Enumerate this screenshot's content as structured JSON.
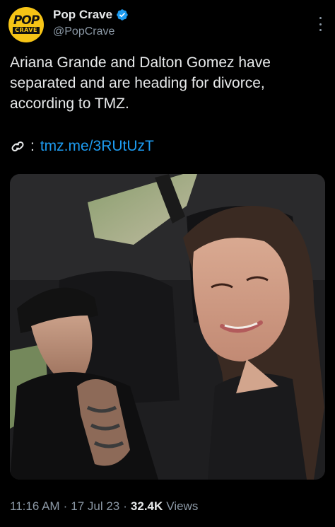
{
  "account": {
    "display_name": "Pop Crave",
    "handle": "@PopCrave",
    "avatar_text_top": "POP",
    "avatar_text_bottom": "CRAVE",
    "verified": true,
    "avatar_color": "#f6c416"
  },
  "tweet": {
    "text": "Ariana Grande and Dalton Gomez have separated and are heading for divorce, according to TMZ.",
    "link_prefix": ":",
    "link_text": "tmz.me/3RUtUzT",
    "link_color": "#1d9bf0",
    "link_icon": "link-icon"
  },
  "media": {
    "icon": "photo"
  },
  "meta": {
    "time": "11:16 AM",
    "date": "17 Jul 23",
    "views_count": "32.4K",
    "views_label": "Views",
    "separator": "·"
  },
  "colors": {
    "background": "#000000",
    "text_primary": "#e7e9ea",
    "text_secondary": "#8b98a5",
    "verified_blue": "#1d9bf0"
  }
}
